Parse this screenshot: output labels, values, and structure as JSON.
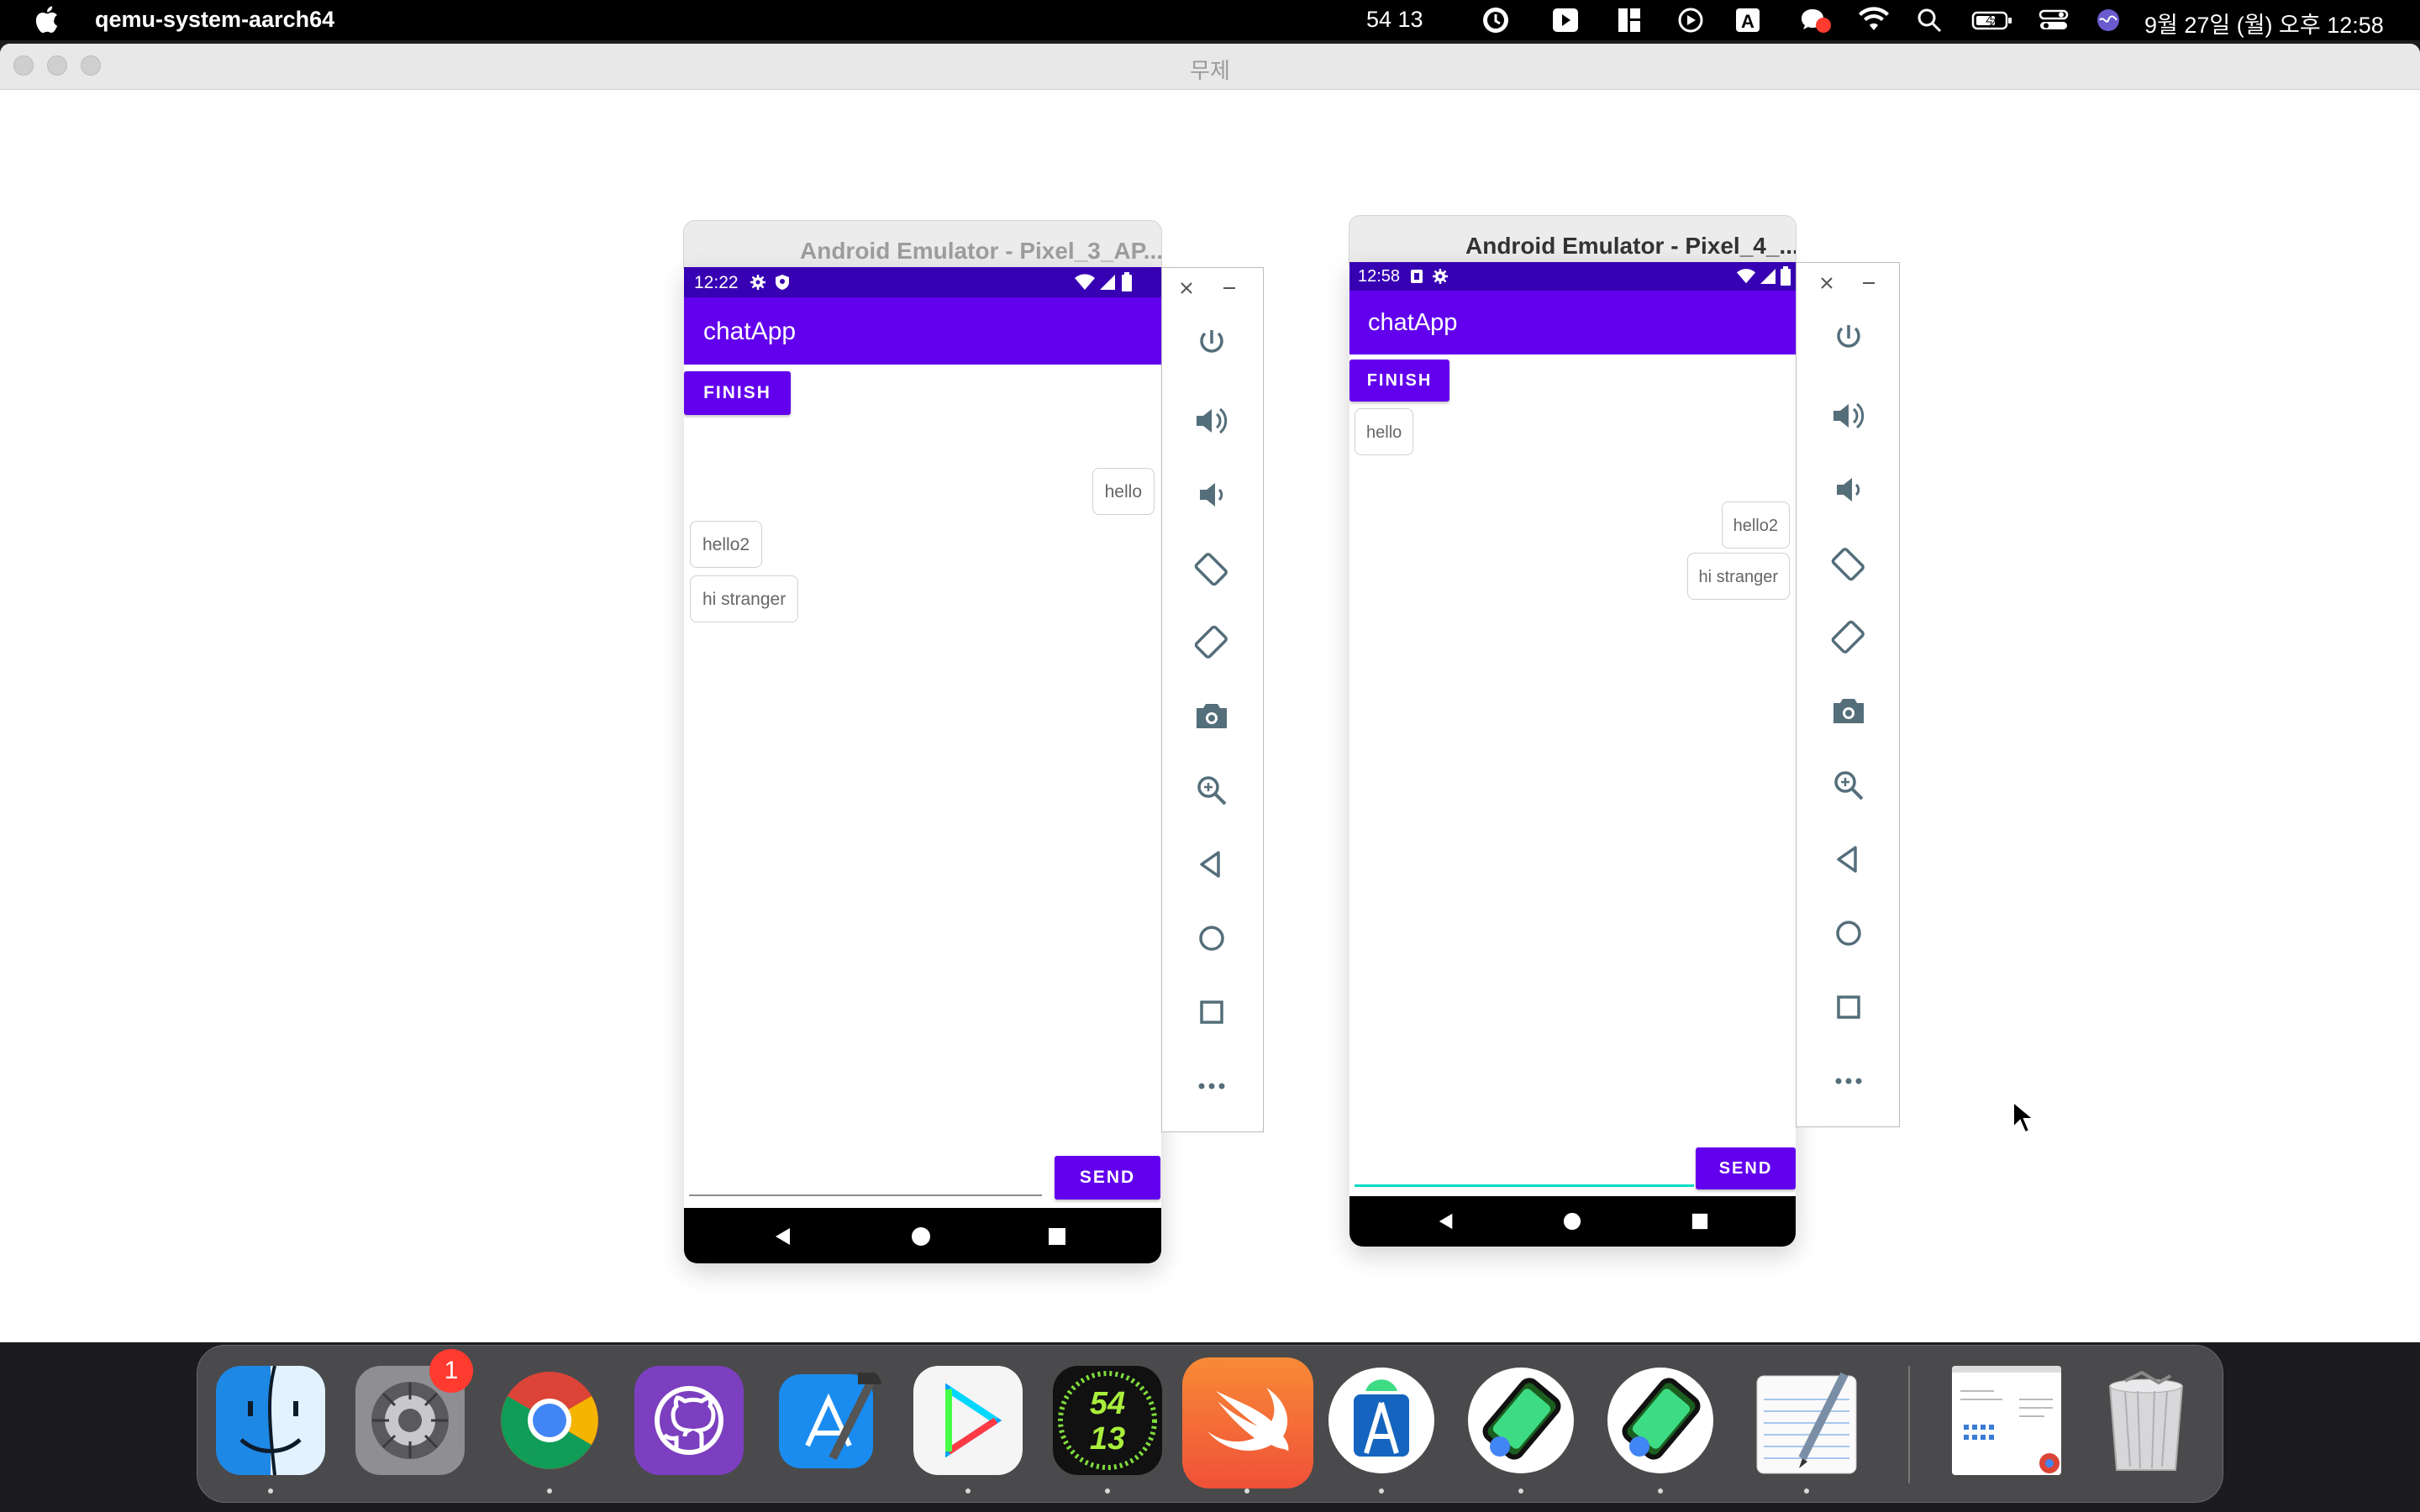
{
  "menubar": {
    "app_name": "qemu-system-aarch64",
    "status_numbers": "54  13",
    "datetime": "9월 27일 (월) 오후  12:58"
  },
  "window": {
    "title": "무제"
  },
  "emulator_left": {
    "window_title": "Android Emulator - Pixel_3_AP...",
    "status_time": "12:22",
    "app_title": "chatApp",
    "finish_label": "FINISH",
    "send_label": "SEND",
    "messages": [
      {
        "text": "hello",
        "side": "right"
      },
      {
        "text": "hello2",
        "side": "left"
      },
      {
        "text": "hi stranger",
        "side": "left"
      }
    ],
    "input_value": ""
  },
  "emulator_right": {
    "window_title": "Android Emulator - Pixel_4_...",
    "status_time": "12:58",
    "app_title": "chatApp",
    "finish_label": "FINISH",
    "send_label": "SEND",
    "messages": [
      {
        "text": "hello",
        "side": "left"
      },
      {
        "text": "hello2",
        "side": "right"
      },
      {
        "text": "hi stranger",
        "side": "right"
      }
    ],
    "input_value": ""
  },
  "emulator_tools": [
    "close-icon",
    "minimize-icon",
    "power-icon",
    "volume-up-icon",
    "volume-down-icon",
    "rotate-left-icon",
    "rotate-right-icon",
    "camera-icon",
    "zoom-icon",
    "back-icon",
    "home-icon",
    "overview-icon",
    "more-icon"
  ],
  "dock": {
    "apps": [
      "Finder",
      "System Preferences",
      "Google Chrome",
      "GitHub Desktop",
      "Xcode",
      "Google Play",
      "Clock",
      "Swift Playgrounds",
      "Android Studio",
      "Android Emulator",
      "Android Emulator",
      "TextEdit",
      "Document",
      "Trash"
    ],
    "settings_badge": "1",
    "clock_top": "54",
    "clock_bottom": "13"
  },
  "colors": {
    "primary": "#6200ee",
    "primary_dark": "#3700b3",
    "accent": "#03dac5"
  }
}
